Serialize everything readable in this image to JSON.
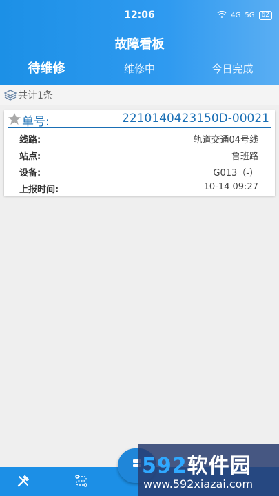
{
  "statusbar": {
    "time": "12:06",
    "battery": "62",
    "signal1": "4G",
    "signal2": "5G"
  },
  "header": {
    "title": "故障看板"
  },
  "tabs": [
    {
      "label": "待维修",
      "active": true
    },
    {
      "label": "维修中",
      "active": false
    },
    {
      "label": "今日完成",
      "active": false
    }
  ],
  "summary": {
    "count_text": "共计1条"
  },
  "card": {
    "ticket_label": "单号:",
    "ticket_number": "2210140423150D-00021",
    "rows": [
      {
        "key": "线路:",
        "value": "轨道交通04号线"
      },
      {
        "key": "站点:",
        "value": "鲁班路"
      },
      {
        "key": "设备:",
        "value": "G013（-）"
      },
      {
        "key": "上报时间:",
        "value": "10-14 09:27"
      }
    ]
  },
  "bottom_nav": {
    "icons": [
      "tools-icon",
      "route-icon"
    ]
  },
  "watermark": {
    "logo_num": "592",
    "logo_text": "软件园",
    "url": "www.592xiazai.com"
  },
  "colors": {
    "primary": "#1c90e6",
    "accent_text": "#1a6fb5",
    "background": "#efefef"
  }
}
